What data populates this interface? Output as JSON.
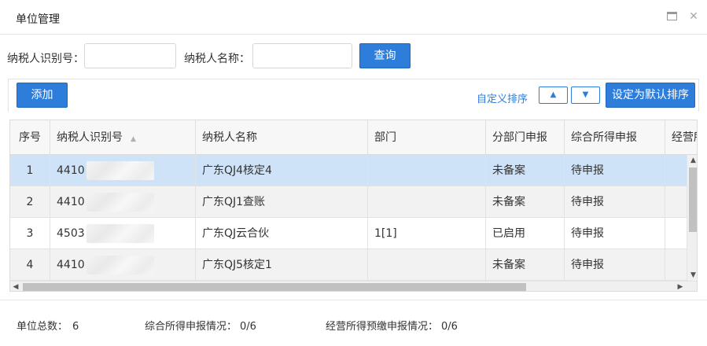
{
  "window": {
    "title": "单位管理"
  },
  "search": {
    "taxpayer_id_label": "纳税人识别号：",
    "taxpayer_id_value": "",
    "taxpayer_name_label": "纳税人名称：",
    "taxpayer_name_value": "",
    "query_label": "查询"
  },
  "toolbar": {
    "add_label": "添加",
    "custom_sort_label": "自定义排序",
    "up_label": "▲",
    "down_label": "▼",
    "set_default_label": "设定为默认排序"
  },
  "table": {
    "columns": [
      "序号",
      "纳税人识别号",
      "纳税人名称",
      "部门",
      "分部门申报",
      "综合所得申报",
      "经营所"
    ],
    "rows": [
      {
        "index": "1",
        "taxpayer_id": "4410",
        "name": "广东QJ4核定4",
        "dept": "",
        "dept_filing": "未备案",
        "comprehensive": "待申报"
      },
      {
        "index": "2",
        "taxpayer_id": "4410",
        "name": "广东QJ1查账",
        "dept": "",
        "dept_filing": "未备案",
        "comprehensive": "待申报"
      },
      {
        "index": "3",
        "taxpayer_id": "4503",
        "name": "广东QJ云合伙",
        "dept": "1[1]",
        "dept_filing": "已启用",
        "comprehensive": "待申报"
      },
      {
        "index": "4",
        "taxpayer_id": "4410",
        "name": "广东QJ5核定1",
        "dept": "",
        "dept_filing": "未备案",
        "comprehensive": "待申报"
      }
    ],
    "selected_row": 1
  },
  "footer": {
    "unit_total_label": "单位总数：",
    "unit_total_value": "6",
    "comprehensive_label": "综合所得申报情况：",
    "comprehensive_value": "0/6",
    "business_label": "经营所得预缴申报情况：",
    "business_value": "0/6"
  },
  "colors": {
    "accent": "#2f7ddb",
    "selected_row": "#cfe3f8",
    "alt_row": "#f2f2f2"
  }
}
